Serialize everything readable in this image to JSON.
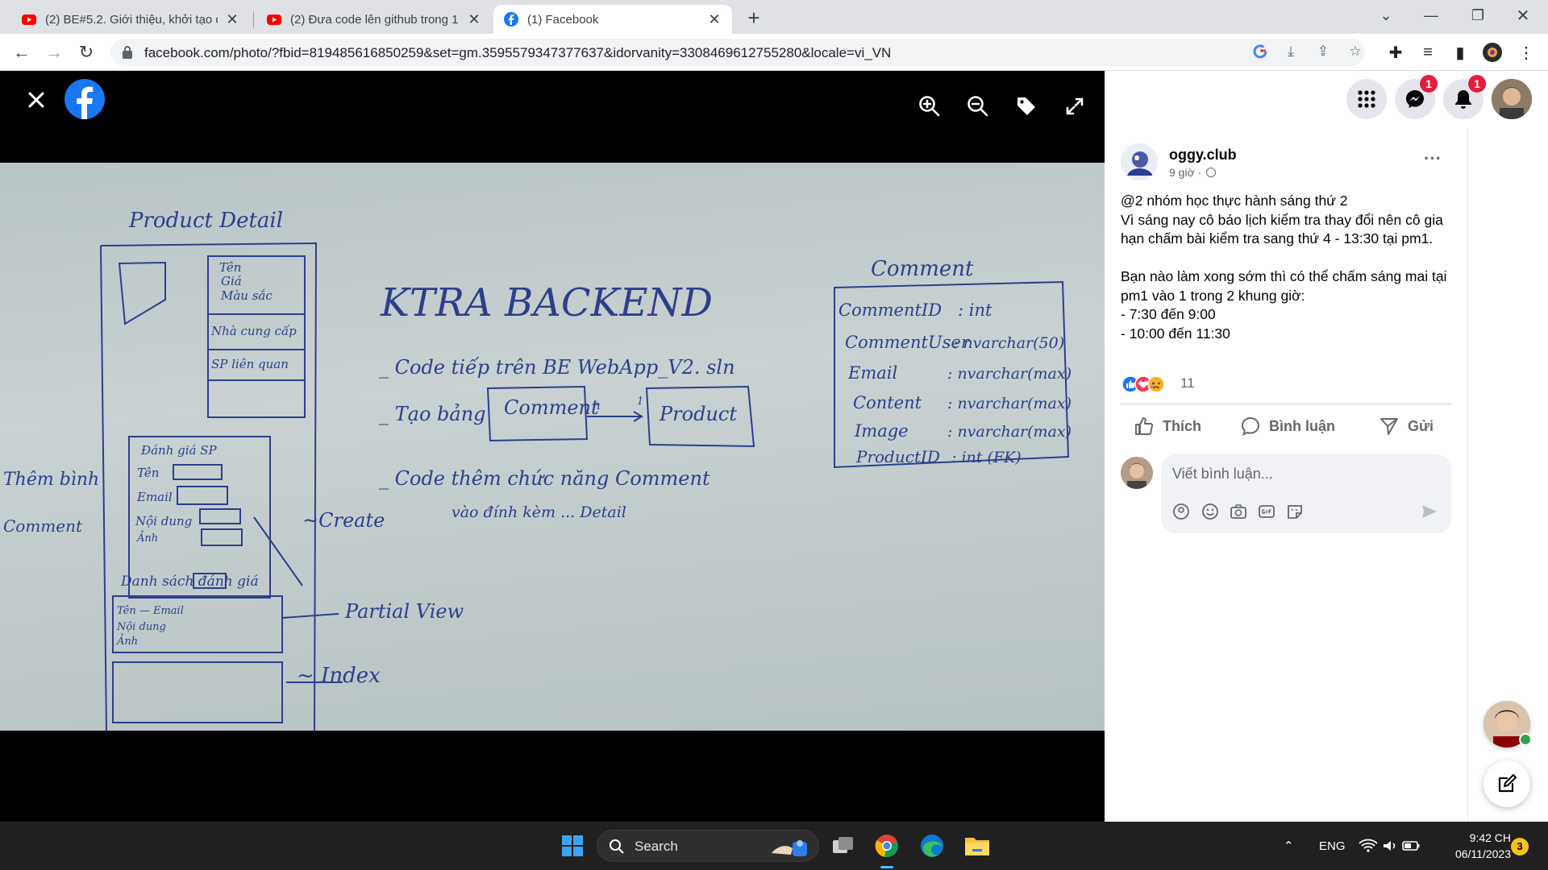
{
  "browser": {
    "tabs": [
      {
        "title": "(2) BE#5.2. Giới thiệu, khởi tạo dự",
        "icon": "youtube-icon"
      },
      {
        "title": "(2) Đưa code lên github trong 1",
        "icon": "youtube-icon"
      },
      {
        "title": "(1) Facebook",
        "icon": "facebook-icon",
        "active": true
      }
    ],
    "url": "facebook.com/photo/?fbid=819485616850259&set=gm.3595579347377637&idorvanity=3308469612755280&locale=vi_VN"
  },
  "header": {
    "messenger_badge": "1",
    "notifications_badge": "1"
  },
  "whiteboard": {
    "title": "KTRA BACKEND",
    "left_title": "Product Detail",
    "box_labels": [
      "Tên",
      "Giá",
      "Màu sắc",
      "Nhà cung cấp",
      "SP liên quan"
    ],
    "rating_title": "Đánh giá SP",
    "rating_fields": [
      "Tên",
      "Email",
      "Nội dung",
      "Ảnh"
    ],
    "side_labels": [
      "Thêm bình",
      "Comment"
    ],
    "list_title": "Danh sách đánh giá",
    "list_fields": [
      "Tên — Email",
      "Nội dung",
      "Ảnh"
    ],
    "arrows": [
      "~Create",
      "Partial View",
      "~ Index"
    ],
    "items": [
      "_ Code tiếp trên BE WebApp_V2. sln",
      "_ Tạo bảng",
      "_ Code thêm chức năng Comment",
      "vào đính kèm ... Detail"
    ],
    "entity_left": "Comment",
    "entity_right": "Product",
    "relation": "n",
    "relation_end": "1",
    "table_title": "Comment",
    "table_rows": [
      [
        "CommentID",
        ": int"
      ],
      [
        "CommentUser",
        ": nvarchar(50)"
      ],
      [
        "Email",
        ": nvarchar(max)"
      ],
      [
        "Content",
        ": nvarchar(max)"
      ],
      [
        "Image",
        ": nvarchar(max)"
      ],
      [
        "ProductID",
        ": int (FK)"
      ]
    ]
  },
  "post": {
    "author": "oggy.club",
    "time": "9 giờ ·",
    "lines": [
      "@2 nhóm học thực hành sáng thứ 2",
      "Vì sáng nay cô báo lịch kiểm tra thay đổi nên cô gia hạn chấm bài kiểm tra sang thứ 4 - 13:30 tại pm1.",
      "",
      "Bạn nào làm xong sớm thì có thể chấm sáng mai tại pm1 vào 1 trong 2 khung giờ:",
      "- 7:30 đến 9:00",
      "- 10:00 đến 11:30"
    ],
    "reaction_count": "11",
    "actions": {
      "like": "Thích",
      "comment": "Bình luận",
      "share": "Gửi"
    },
    "comment_placeholder": "Viết bình luận..."
  },
  "taskbar": {
    "search": "Search",
    "lang": "ENG",
    "time": "9:42 CH",
    "date": "06/11/2023",
    "notification_count": "3"
  },
  "colors": {
    "facebook_blue": "#1877f2",
    "ink": "#2c3f8a"
  }
}
